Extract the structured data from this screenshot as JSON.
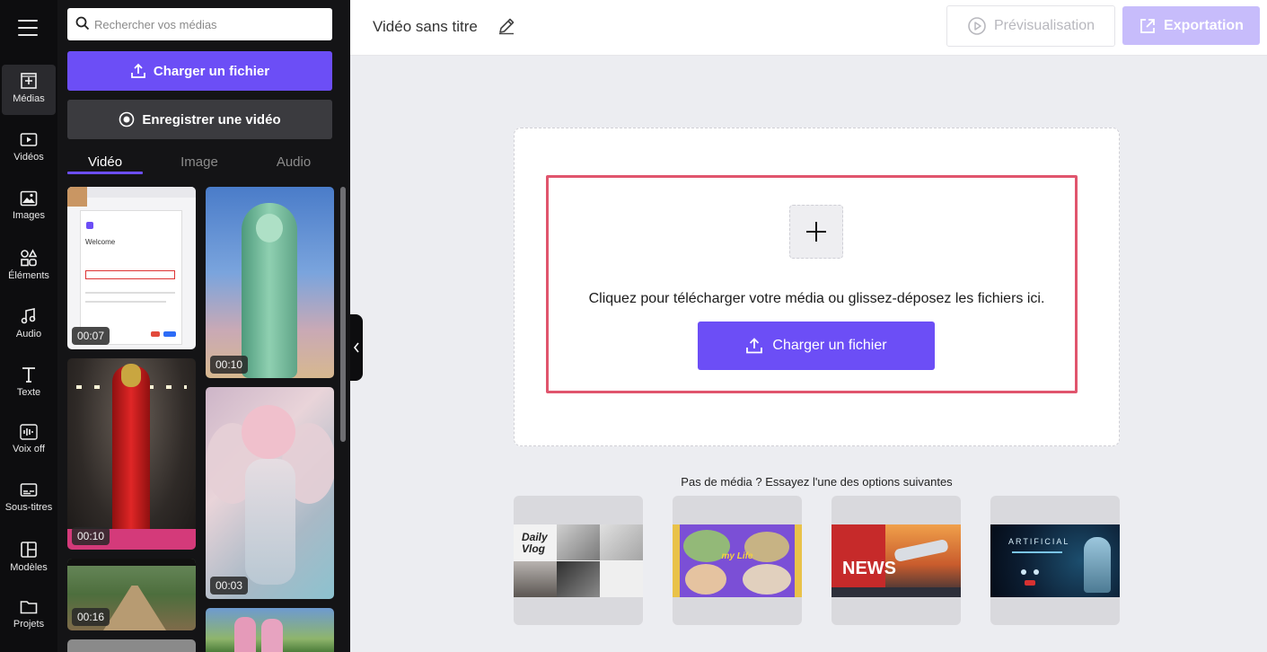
{
  "rail": {
    "items": [
      {
        "label": "Médias",
        "icon": "add-media-icon",
        "active": true
      },
      {
        "label": "Vidéos",
        "icon": "video-icon"
      },
      {
        "label": "Images",
        "icon": "image-icon"
      },
      {
        "label": "Éléments",
        "icon": "shapes-icon"
      },
      {
        "label": "Audio",
        "icon": "music-note-icon"
      },
      {
        "label": "Texte",
        "icon": "text-icon"
      },
      {
        "label": "Voix off",
        "icon": "waveform-icon"
      },
      {
        "label": "Sous-titres",
        "icon": "subtitles-icon"
      },
      {
        "label": "Modèles",
        "icon": "template-icon"
      },
      {
        "label": "Projets",
        "icon": "folder-icon"
      }
    ]
  },
  "panel": {
    "search_placeholder": "Rechercher vos médias",
    "upload_label": "Charger un fichier",
    "record_label": "Enregistrer une vidéo",
    "tabs": [
      "Vidéo",
      "Image",
      "Audio"
    ],
    "thumbs": [
      {
        "duration": "00:07",
        "desc": "screenshot-welcome"
      },
      {
        "duration": "00:10",
        "desc": "statue"
      },
      {
        "duration": "00:10",
        "desc": "ironman"
      },
      {
        "duration": "00:03",
        "desc": "angel"
      },
      {
        "duration": "00:16",
        "desc": "road"
      },
      {
        "duration": "",
        "desc": "people"
      },
      {
        "duration": "",
        "desc": "gray"
      }
    ],
    "welcome_text": "Welcome"
  },
  "header": {
    "title": "Vidéo sans titre",
    "preview_label": "Prévisualisation",
    "export_label": "Exportation"
  },
  "dropzone": {
    "text": "Cliquez pour télécharger votre média ou glissez-déposez les fichiers ici.",
    "button_label": "Charger un fichier"
  },
  "suggestions": {
    "title": "Pas de média ? Essayez l'une des options suivantes",
    "cards": [
      {
        "name": "daily-vlog",
        "text_a": "Daily",
        "text_b": "Vlog"
      },
      {
        "name": "my-life",
        "text_a": "my Life"
      },
      {
        "name": "news",
        "text_a": "NEWS"
      },
      {
        "name": "artificial",
        "text_a": "ARTIFICIAL"
      }
    ]
  },
  "colors": {
    "accent": "#6c4ef6",
    "highlight": "#e0556d"
  }
}
